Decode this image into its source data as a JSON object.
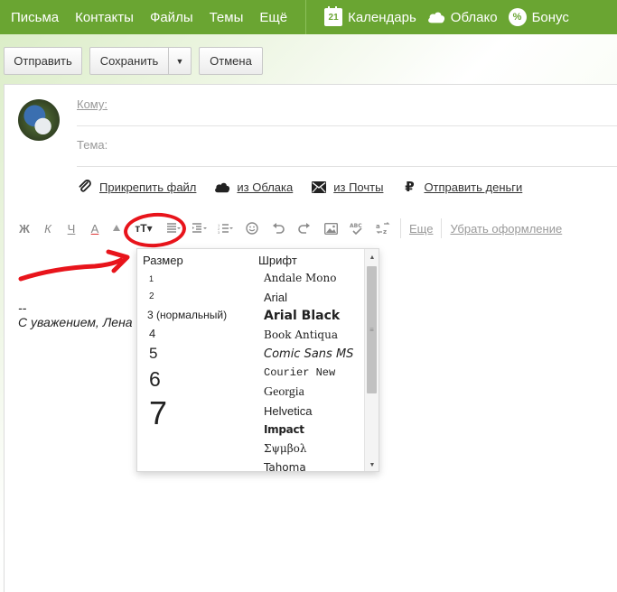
{
  "nav": {
    "items": [
      "Письма",
      "Контакты",
      "Файлы",
      "Темы",
      "Ещё"
    ],
    "services": [
      {
        "label": "Календарь",
        "icon": "calendar-icon",
        "badge": "21"
      },
      {
        "label": "Облако",
        "icon": "cloud-icon"
      },
      {
        "label": "Бонус",
        "icon": "bonus-icon",
        "badge": "%"
      }
    ],
    "bg_color": "#6aa532"
  },
  "actions": {
    "send": "Отправить",
    "save": "Сохранить",
    "save_arrow": "▼",
    "cancel": "Отмена"
  },
  "compose": {
    "to_label": "Кому:",
    "subject_label": "Тема:"
  },
  "attach": {
    "file": "Прикрепить файл",
    "cloud": "из Облака",
    "mail": "из Почты",
    "money": "Отправить деньги",
    "money_glyph": "₽"
  },
  "toolbar": {
    "bold": "Ж",
    "italic": "К",
    "underline": "Ч",
    "color": "А",
    "size": "тТ▾",
    "more": "Еще",
    "clear": "Убрать оформление"
  },
  "signature": {
    "dash": "--",
    "text": "С уважением, Лена"
  },
  "dropdown": {
    "size_header": "Размер",
    "font_header": "Шрифт",
    "sizes": [
      "1",
      "2",
      "3 (нормальный)",
      "4",
      "5",
      "6",
      "7"
    ],
    "fonts": [
      "Andale Mono",
      "Arial",
      "Arial Black",
      "Book Antiqua",
      "Comic Sans MS",
      "Courier New",
      "Georgia",
      "Helvetica",
      "Impact",
      "Σψμβολ",
      "Tahoma"
    ]
  },
  "annotation_color": "#e8141b"
}
